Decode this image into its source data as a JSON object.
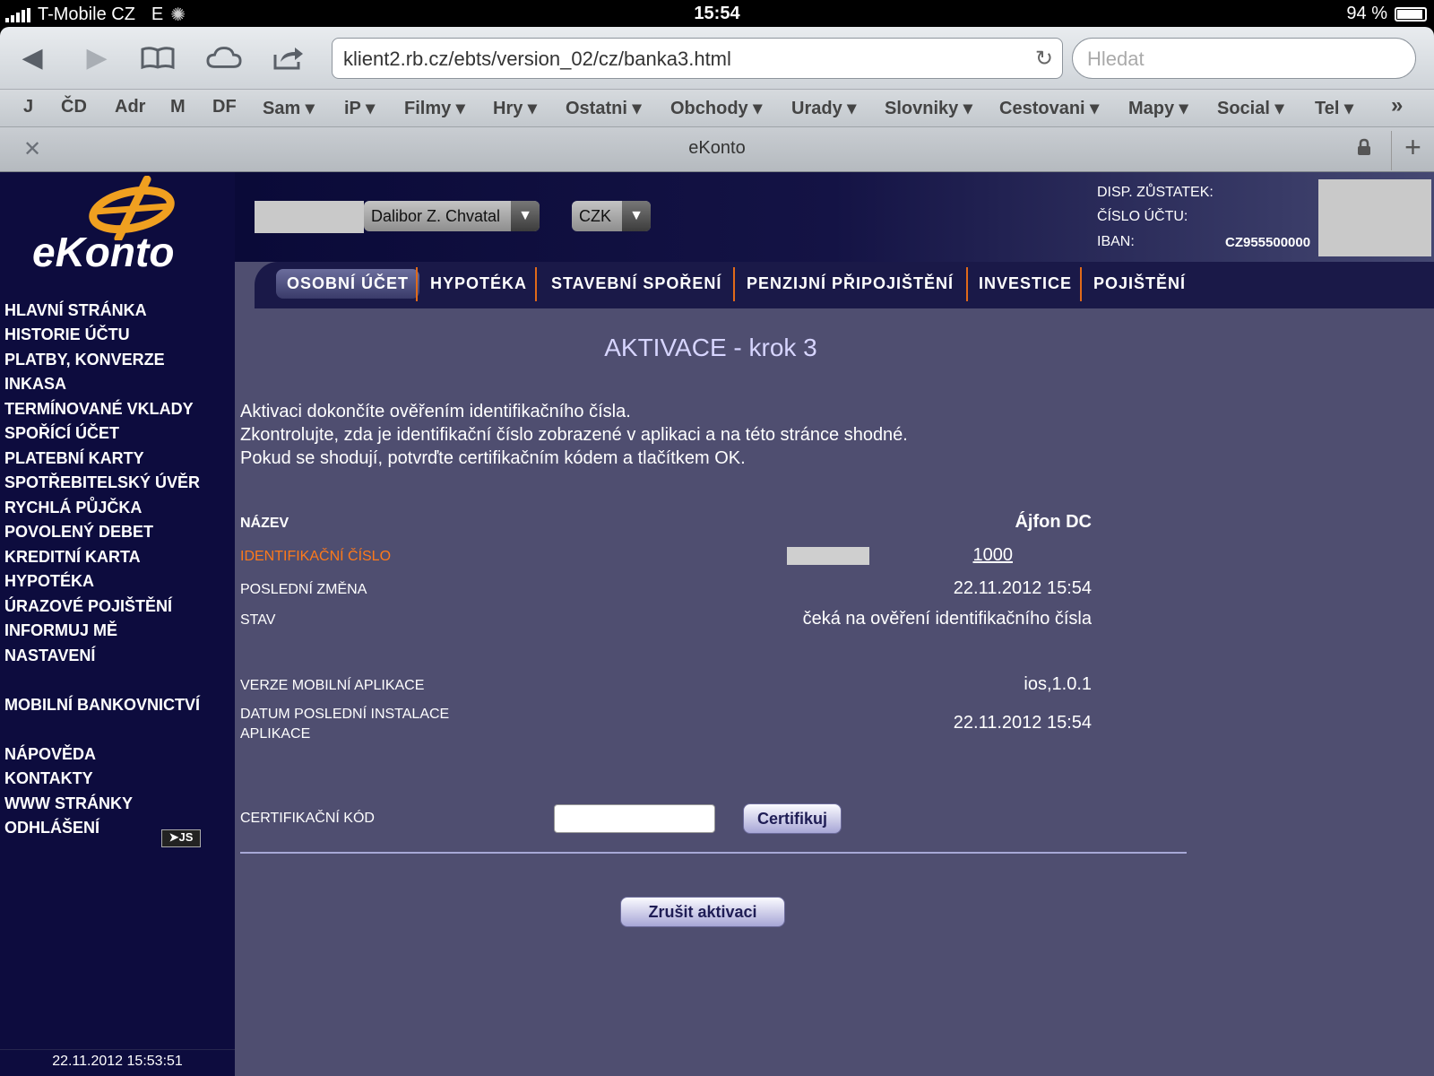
{
  "status_bar": {
    "carrier": "T-Mobile CZ",
    "network": "E",
    "time": "15:54",
    "battery": "94 %"
  },
  "browser": {
    "url": "klient2.rb.cz/ebts/version_02/cz/banka3.html",
    "search_placeholder": "Hledat",
    "bookmarks": [
      "J",
      "ČD",
      "Adr",
      "M",
      "DF",
      "Sam ▾",
      "iP ▾",
      "Filmy ▾",
      "Hry ▾",
      "Ostatni ▾",
      "Obchody ▾",
      "Urady ▾",
      "Slovniky ▾",
      "Cestovani ▾",
      "Mapy ▾",
      "Social ▾",
      "Tel ▾",
      "»"
    ],
    "tab_title": "eKonto"
  },
  "logo_text": "eKonto",
  "sidebar": {
    "items": [
      "HLAVNÍ STRÁNKA",
      "HISTORIE ÚČTU",
      "PLATBY, KONVERZE",
      "INKASA",
      "TERMÍNOVANÉ VKLADY",
      "SPOŘÍCÍ ÚČET",
      "PLATEBNÍ KARTY",
      "SPOTŘEBITELSKÝ ÚVĚR",
      "RYCHLÁ PŮJČKA",
      "POVOLENÝ DEBET",
      "KREDITNÍ KARTA",
      "HYPOTÉKA",
      "ÚRAZOVÉ POJIŠTĚNÍ",
      "INFORMUJ MĚ",
      "NASTAVENÍ"
    ],
    "mobile": "MOBILNÍ BANKOVNICTVÍ",
    "bottom_items": [
      "NÁPOVĚDA",
      "KONTAKTY",
      "WWW STRÁNKY",
      "ODHLÁŠENÍ"
    ],
    "js_badge": "➤JS",
    "timestamp": "22.11.2012 15:53:51"
  },
  "header": {
    "user": "Dalibor Z. Chvatal",
    "currency": "CZK",
    "disp_label": "DISP. ZŮSTATEK:",
    "account_label": "ČÍSLO ÚČTU:",
    "iban_label": "IBAN:",
    "iban_value": "CZ955500000"
  },
  "tabs": [
    "OSOBNÍ ÚČET",
    "HYPOTÉKA",
    "STAVEBNÍ SPOŘENÍ",
    "PENZIJNÍ PŘIPOJIŠTĚNÍ",
    "INVESTICE",
    "POJIŠTĚNÍ"
  ],
  "main": {
    "title": "AKTIVACE - krok 3",
    "intro": [
      "Aktivaci dokončíte ověřením identifikačního čísla.",
      "Zkontrolujte, zda je identifikační číslo zobrazené v aplikaci a na této stránce shodné.",
      "Pokud se shodují, potvrďte certifikačním kódem a tlačítkem OK."
    ],
    "name_label": "NÁZEV",
    "name_value": "Ájfon DC",
    "id_label": "IDENTIFIKAČNÍ ČÍSLO",
    "id_value": "1000",
    "last_change_label": "POSLEDNÍ ZMĚNA",
    "last_change_value": "22.11.2012 15:54",
    "state_label": "STAV",
    "state_value": "čeká na ověření identifikačního čísla",
    "version_label": "VERZE MOBILNÍ APLIKACE",
    "version_value": "ios,1.0.1",
    "install_label": "DATUM POSLEDNÍ INSTALACE APLIKACE",
    "install_value": "22.11.2012 15:54",
    "cert_label": "CERTIFIKAČNÍ KÓD",
    "cert_button": "Certifikuj",
    "cancel_button": "Zrušit aktivaci"
  }
}
